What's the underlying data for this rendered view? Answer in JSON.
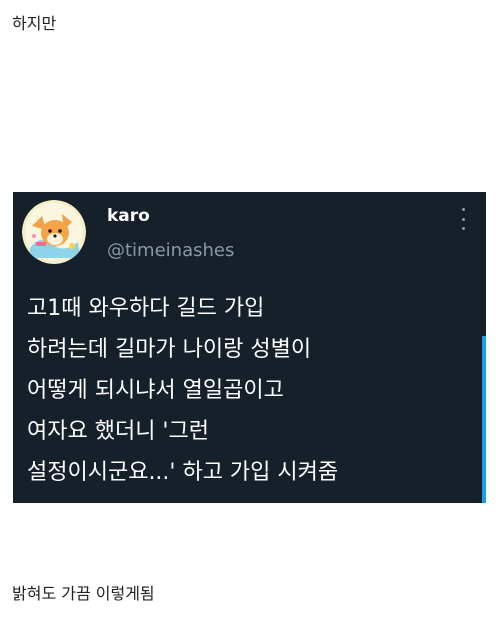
{
  "intro": "하지만",
  "tweet": {
    "display_name": "karo",
    "handle": "@timeinashes",
    "lines": [
      "고1때 와우하다 길드 가입",
      "하려는데 길마가 나이랑 성별이",
      "어떻게 되시냐서 열일곱이고",
      "여자요 했더니 '그런",
      "설정이시군요...' 하고 가입 시켜줌"
    ],
    "colors": {
      "background": "#15202b",
      "text": "#ffffff",
      "muted": "#8899a6",
      "accent": "#1d9bf0"
    }
  },
  "outro": "밝혀도 가끔 이렇게됨"
}
